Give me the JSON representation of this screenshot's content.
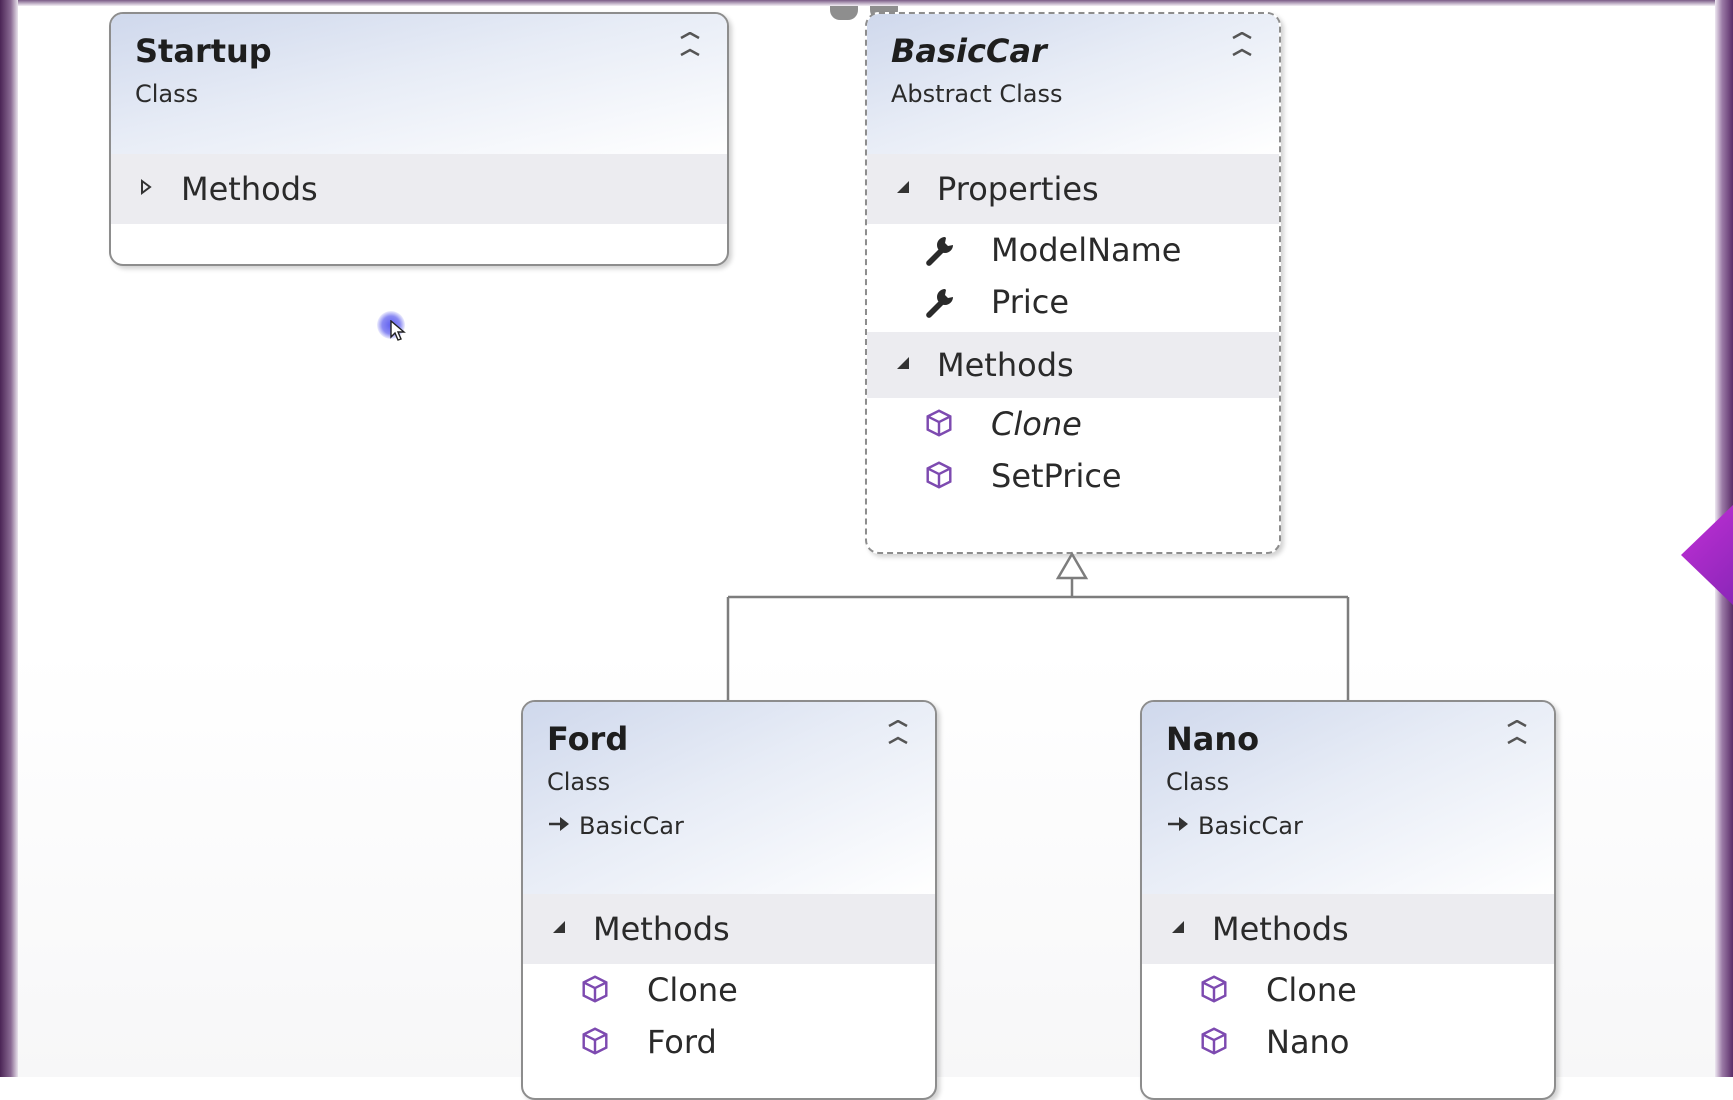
{
  "colors": {
    "box_border": "#8d8d8d",
    "header_gradient": "#cfd8ec",
    "section_bg": "#ececf0",
    "method_icon": "#7d4ab0",
    "wrench_icon": "#2a2a2a",
    "frame": "#5a2c68",
    "wedge": "#c22fd6"
  },
  "icons": {
    "collapse": "double-chevron-up-icon",
    "expand_section": "triangle-right-icon",
    "collapse_section": "triangle-down-icon",
    "property": "wrench-icon",
    "method": "cube-icon",
    "inherit": "arrow-right-icon"
  },
  "classes": {
    "startup": {
      "name": "Startup",
      "kind": "Class",
      "sections": [
        {
          "label": "Methods",
          "expanded": false
        }
      ]
    },
    "basiccar": {
      "name": "BasicCar",
      "kind": "Abstract Class",
      "properties_label": "Properties",
      "properties": [
        "ModelName",
        "Price"
      ],
      "methods_label": "Methods",
      "methods": [
        "Clone",
        "SetPrice"
      ]
    },
    "ford": {
      "name": "Ford",
      "kind": "Class",
      "base": "BasicCar",
      "methods_label": "Methods",
      "methods": [
        "Clone",
        "Ford"
      ]
    },
    "nano": {
      "name": "Nano",
      "kind": "Class",
      "base": "BasicCar",
      "methods_label": "Methods",
      "methods": [
        "Clone",
        "Nano"
      ]
    }
  }
}
